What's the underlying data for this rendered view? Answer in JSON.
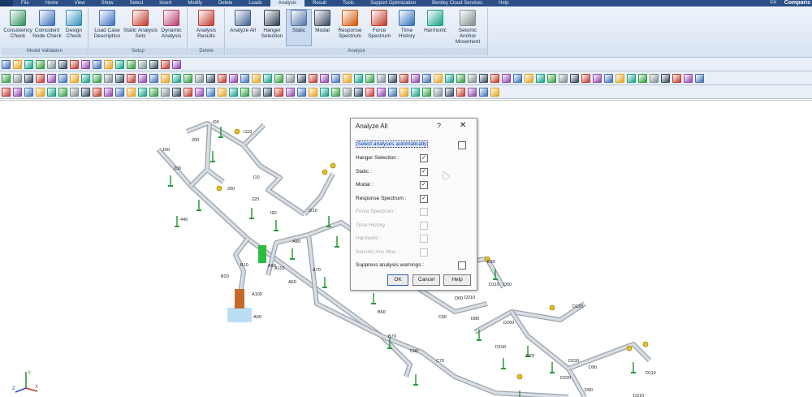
{
  "menu": {
    "items": [
      "File",
      "Home",
      "View",
      "Show",
      "Select",
      "Insert",
      "Modify",
      "Delete",
      "Loads",
      "Analysis",
      "Result",
      "Tools",
      "Support Optimization",
      "Bentley Cloud Services",
      "Help"
    ],
    "active": "Analysis",
    "corner_text": "Comparis",
    "mini_text": "Cu"
  },
  "ribbon": {
    "groups": [
      {
        "title": "Model Validation",
        "buttons": [
          {
            "label": "Consistency Check",
            "color": "#2f8f5a"
          },
          {
            "label": "Coincident Node Check",
            "color": "#3a6fb8"
          },
          {
            "label": "Design Check",
            "color": "#2f8fbf"
          }
        ]
      },
      {
        "title": "Setup",
        "buttons": [
          {
            "label": "Load Case Description",
            "color": "#3b6fc2"
          },
          {
            "label": "Static Analysis Sets",
            "color": "#c0392b"
          },
          {
            "label": "Dynamic Analysis",
            "color": "#b83a6a"
          }
        ]
      },
      {
        "title": "Delete",
        "buttons": [
          {
            "label": "Analysis Results",
            "color": "#c0392b"
          }
        ]
      },
      {
        "title": "Analyze",
        "buttons": [
          {
            "label": "Analyze All",
            "color": "#3c5f8f"
          },
          {
            "label": "Hanger Selection",
            "color": "#2c3e50"
          },
          {
            "label": "Static",
            "color": "#4f74a8"
          },
          {
            "label": "Modal",
            "color": "#34495e"
          },
          {
            "label": "Response Spectrum",
            "color": "#d35400"
          },
          {
            "label": "Force Spectrum",
            "color": "#c0392b"
          },
          {
            "label": "Time History",
            "color": "#2c6fbb"
          },
          {
            "label": "Harmonic",
            "color": "#16a085"
          },
          {
            "label": "Seismic Anchor Movement",
            "color": "#7f8c8d"
          }
        ]
      }
    ]
  },
  "dialog": {
    "title": "Analyze All",
    "help_symbol": "?",
    "close_symbol": "✕",
    "check_mark": "✓",
    "select_auto_label": "Select analyses automatically",
    "options": [
      {
        "label": "Hanger Selection :",
        "checked": true,
        "enabled": true
      },
      {
        "label": "Static :",
        "checked": true,
        "enabled": true
      },
      {
        "label": "Modal :",
        "checked": true,
        "enabled": true
      },
      {
        "label": "Response Spectrum :",
        "checked": true,
        "enabled": true
      },
      {
        "label": "Force Spectrum :",
        "checked": false,
        "enabled": false
      },
      {
        "label": "Time History :",
        "checked": false,
        "enabled": false
      },
      {
        "label": "Harmonic :",
        "checked": false,
        "enabled": false
      },
      {
        "label": "Seismic Anc.Mov. :",
        "checked": false,
        "enabled": false
      }
    ],
    "suppress_label": "Suppress analysis warnings :",
    "buttons": {
      "ok": "OK",
      "cancel": "Cancel",
      "help": "Help"
    }
  },
  "model": {
    "node_labels": [
      "160",
      "200",
      "I00",
      "I110",
      "230",
      "440",
      "200",
      "220",
      "I10",
      "I210",
      "I90",
      "A60",
      "A70",
      "A80",
      "A100",
      "A90",
      "A110",
      "B10",
      "B20",
      "A00",
      "E30",
      "D50",
      "D60",
      "D80",
      "D100",
      "C90",
      "C70",
      "B60",
      "B70",
      "C60",
      "D110",
      "D210",
      "D200",
      "D230",
      "D220",
      "D70",
      "D90",
      "D110",
      "D90",
      "D120",
      "D210"
    ],
    "accent_pipe": "#d8dde4",
    "support_color": "#2e9b3a",
    "axis_labels": [
      "X",
      "Y",
      "Z"
    ]
  }
}
